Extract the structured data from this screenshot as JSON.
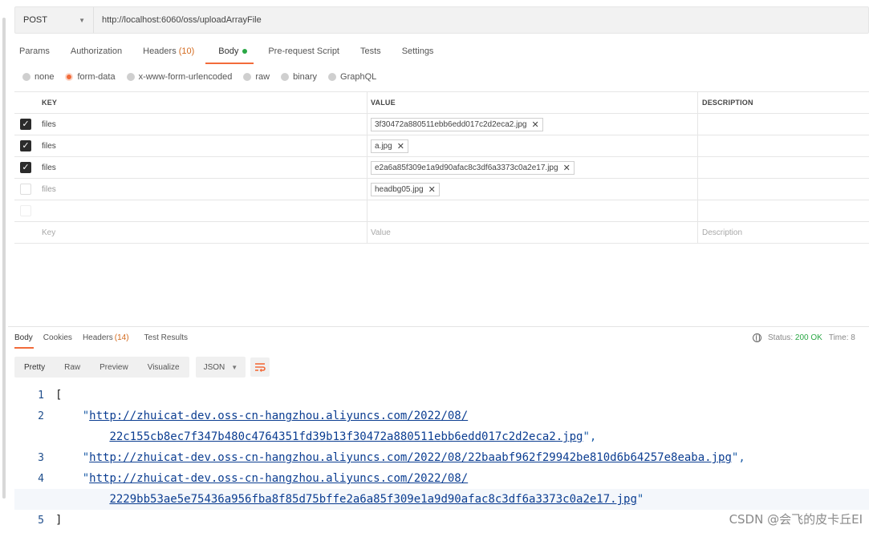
{
  "request": {
    "method": "POST",
    "url": "http://localhost:6060/oss/uploadArrayFile"
  },
  "request_tabs": [
    {
      "label": "Params"
    },
    {
      "label": "Authorization"
    },
    {
      "label": "Headers",
      "count": "(10)"
    },
    {
      "label": "Body"
    },
    {
      "label": "Pre-request Script"
    },
    {
      "label": "Tests"
    },
    {
      "label": "Settings"
    }
  ],
  "body_types": [
    "none",
    "form-data",
    "x-www-form-urlencoded",
    "raw",
    "binary",
    "GraphQL"
  ],
  "table": {
    "headers": {
      "key": "KEY",
      "value": "VALUE",
      "description": "DESCRIPTION"
    },
    "rows": [
      {
        "checked": true,
        "key": "files",
        "file": "3f30472a880511ebb6edd017c2d2eca2.jpg"
      },
      {
        "checked": true,
        "key": "files",
        "file": "a.jpg"
      },
      {
        "checked": true,
        "key": "files",
        "file": "e2a6a85f309e1a9d90afac8c3df6a3373c0a2e17.jpg"
      },
      {
        "checked": false,
        "key": "files",
        "file": "headbg05.jpg"
      }
    ],
    "placeholders": {
      "key": "Key",
      "value": "Value",
      "description": "Description"
    }
  },
  "response_tabs": [
    {
      "label": "Body"
    },
    {
      "label": "Cookies"
    },
    {
      "label": "Headers",
      "count": "(14)"
    },
    {
      "label": "Test Results"
    }
  ],
  "status": {
    "label": "Status:",
    "value": "200 OK",
    "time_label": "Time: 8"
  },
  "view_modes": [
    "Pretty",
    "Raw",
    "Preview",
    "Visualize"
  ],
  "format": "JSON",
  "code_lines": {
    "l1": "[",
    "l2a": "http://zhuicat-dev.oss-cn-hangzhou.aliyuncs.com/2022/08/",
    "l2b": "22c155cb8ec7f347b480c4764351fd39b13f30472a880511ebb6edd017c2d2eca2.jpg",
    "l3": "http://zhuicat-dev.oss-cn-hangzhou.aliyuncs.com/2022/08/22baabf962f29942be810d6b64257e8eaba.jpg",
    "l4a": "http://zhuicat-dev.oss-cn-hangzhou.aliyuncs.com/2022/08/",
    "l4b": "2229bb53ae5e75436a956fba8f85d75bffe2a6a85f309e1a9d90afac8c3df6a3373c0a2e17.jpg",
    "l5": "]"
  },
  "line_numbers": [
    "1",
    "2",
    "3",
    "4",
    "5"
  ],
  "watermark": "CSDN @会飞的皮卡丘EI",
  "colors": {
    "accent": "#f26b3a",
    "ok": "#2aa745"
  }
}
